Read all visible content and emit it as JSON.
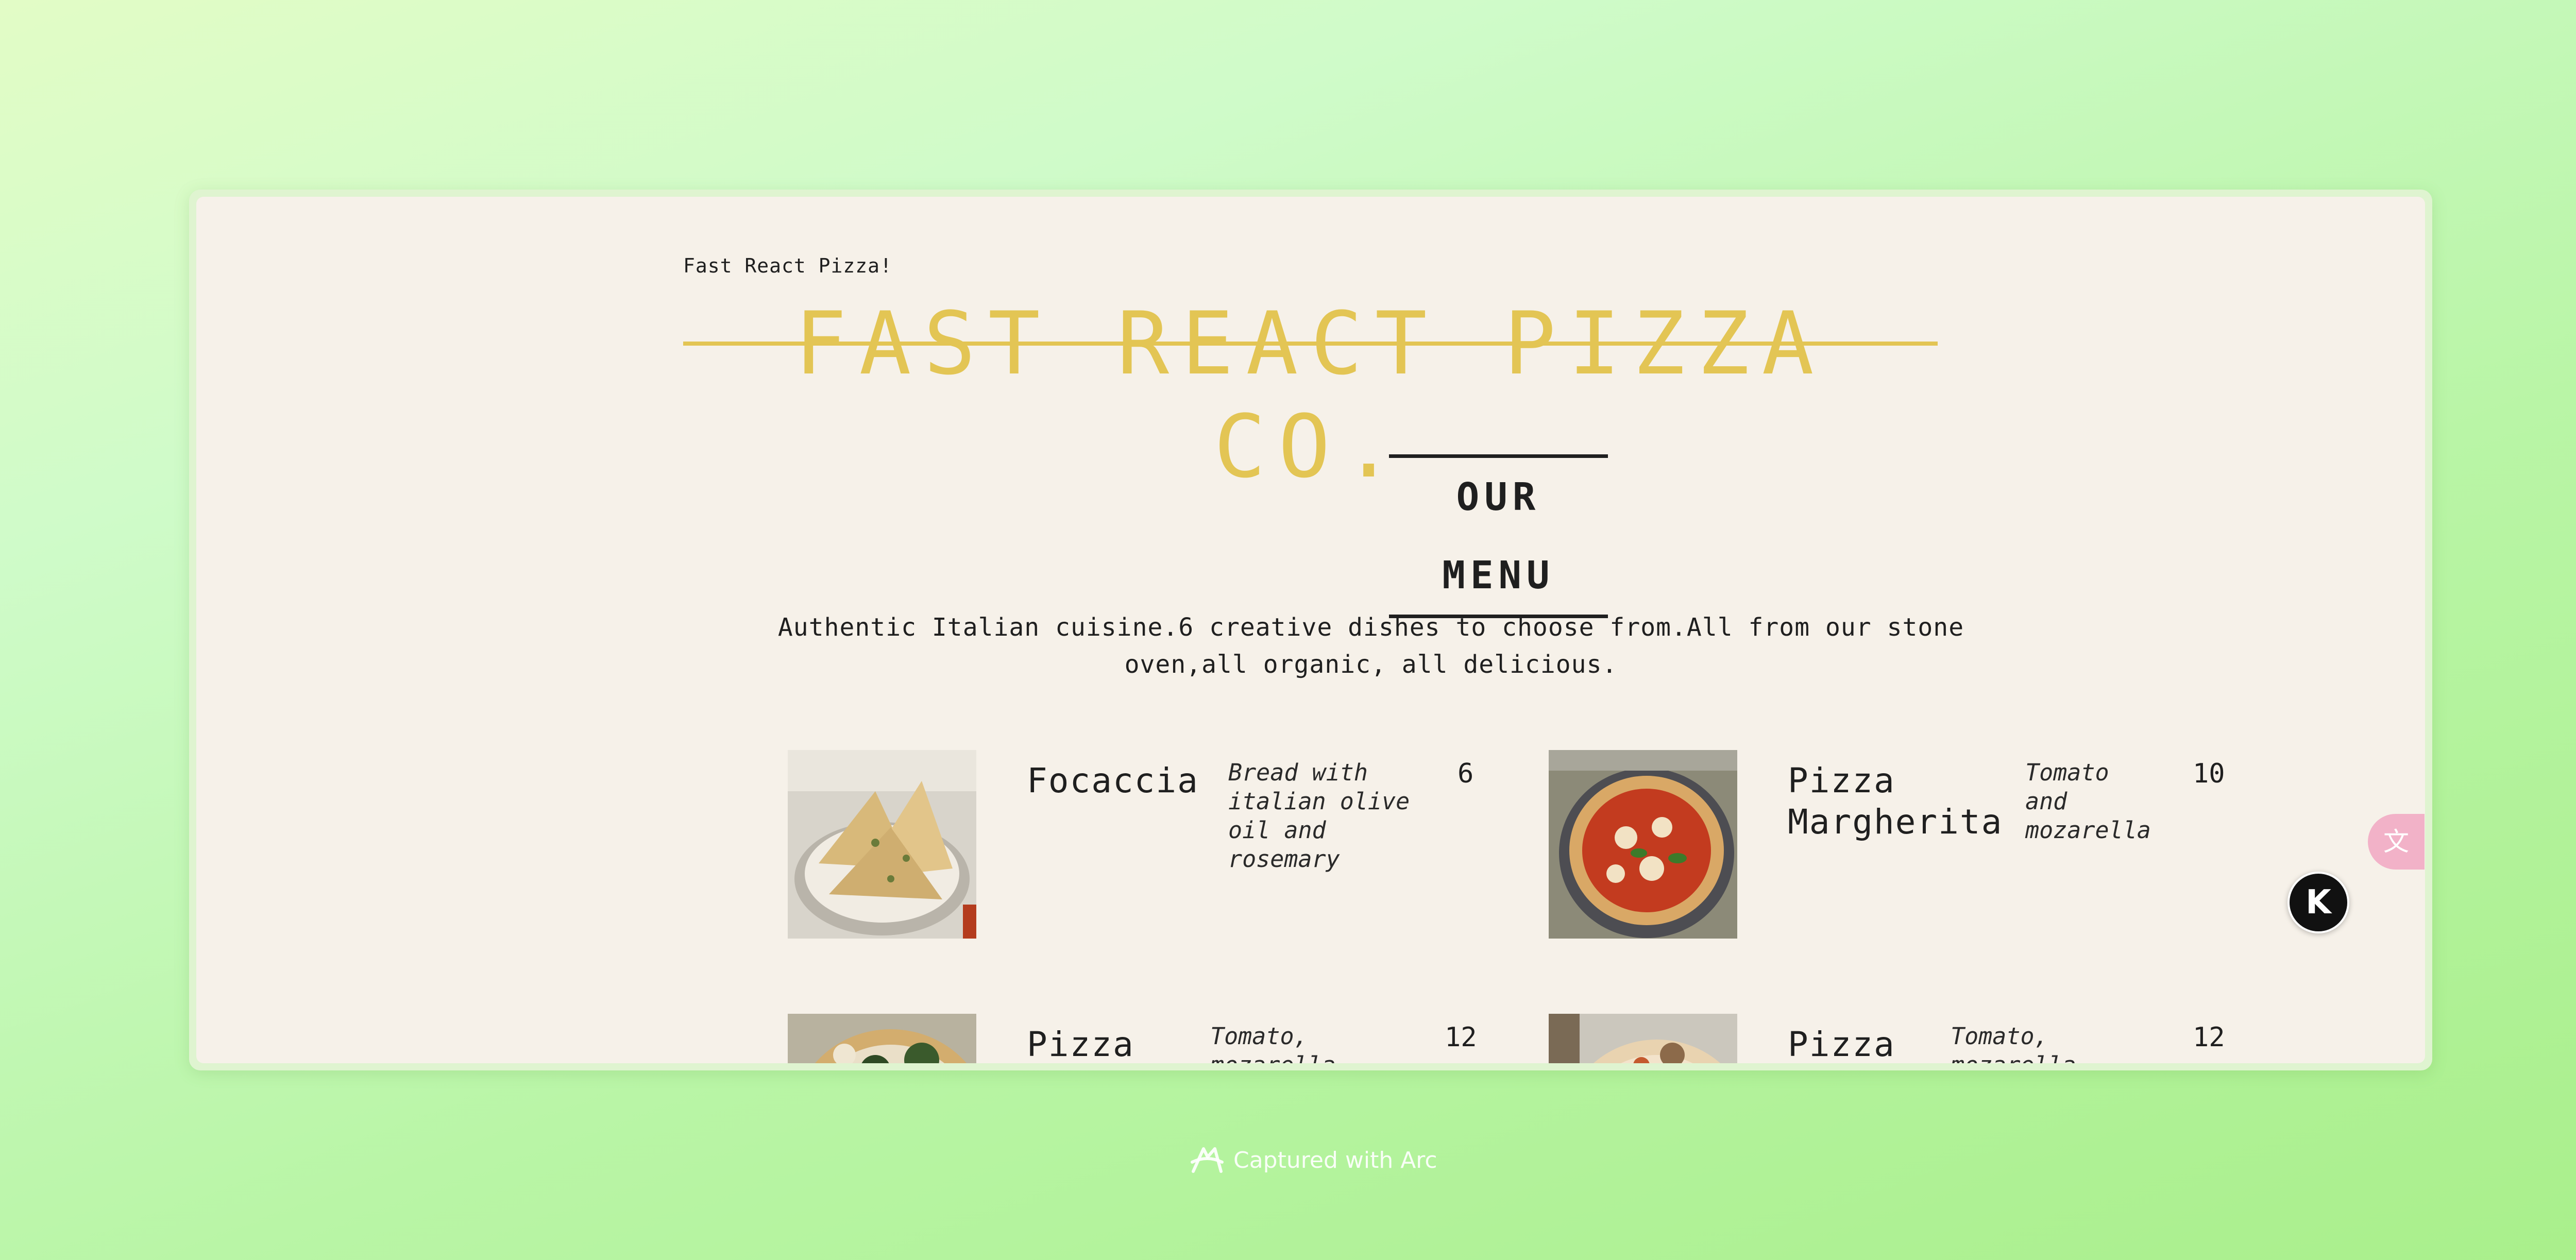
{
  "header": {
    "small_title": "Fast React Pizza!",
    "title": "FAST REACT PIZZA CO."
  },
  "menu": {
    "heading": "OUR MENU",
    "intro": "Authentic Italian cuisine.6 creative dishes to choose from.All from our stone oven,all organic, all delicious."
  },
  "pizzas": [
    {
      "name": "Focaccia",
      "ingredients": "Bread with italian olive oil and rosemary",
      "price": "6",
      "image_icon": "focaccia-photo"
    },
    {
      "name": "Pizza Margherita",
      "ingredients": "Tomato and mozarella",
      "price": "10",
      "image_icon": "margherita-photo"
    },
    {
      "name": "Pizza Spinaci",
      "ingredients": "Tomato, mozarella,",
      "price": "12",
      "image_icon": "spinaci-photo"
    },
    {
      "name": "Pizza Funghi",
      "ingredients": "Tomato, mozarella,",
      "price": "12",
      "image_icon": "funghi-photo"
    }
  ],
  "widgets": {
    "translate_icon": "translate-icon",
    "k_badge": "K"
  },
  "footer": {
    "captured": "Captured with Arc"
  },
  "colors": {
    "accent": "#e3c554",
    "page_bg": "#f6f1e9",
    "text": "#1f1f1f"
  }
}
